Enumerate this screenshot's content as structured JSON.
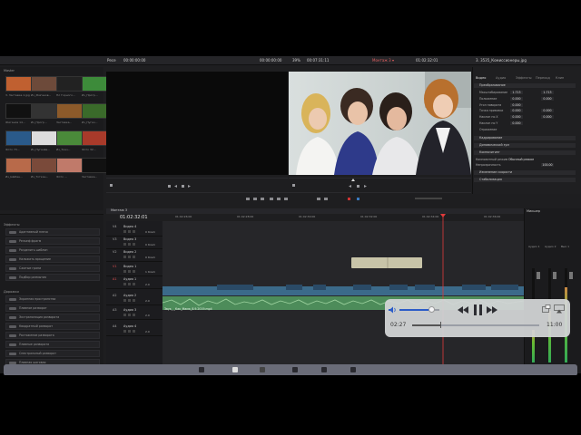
{
  "toolbar": {
    "left_label": "Ресе",
    "left_timecode": "00:00:00:00",
    "mid_timecode": "00:00:00:00",
    "zoom": "39%",
    "center_timecode": "00:07:31:11",
    "timeline_name": "Монтаж 3 ▾",
    "right_timecode": "01:02:32:01",
    "clip_name": "3. 3535_Комиссионеры.jpg"
  },
  "pool": {
    "title": "Master",
    "clips": [
      {
        "label": "3. Заставка-1.jpg",
        "color": "#c06030"
      },
      {
        "label": "Из_Жиганов...",
        "color": "#6d4a3a"
      },
      {
        "label": "Пл Горного...",
        "color": "#222"
      },
      {
        "label": "Из_Прогр...",
        "color": "#3d8b3a"
      },
      {
        "label": "Жиганов 14...",
        "color": "#111"
      },
      {
        "label": "Из_Прогр...",
        "color": "#333"
      },
      {
        "label": "Заставка...",
        "color": "#8c5a2a"
      },
      {
        "label": "Из_Пугач...",
        "color": "#3a6a2a"
      },
      {
        "label": "Фото 73...",
        "color": "#2a5a8a"
      },
      {
        "label": "Из_Пугачёв...",
        "color": "#ddd"
      },
      {
        "label": "Из_Ткач...",
        "color": "#4a8a3a"
      },
      {
        "label": "Фото 32...",
        "color": "#a83a2a"
      },
      {
        "label": "Из_Шабан...",
        "color": "#b86a4a"
      },
      {
        "label": "Из_Тоткин...",
        "color": "#7a4a3a"
      },
      {
        "label": "Фото ...",
        "color": "#c07a6a"
      },
      {
        "label": "Заставка...",
        "color": "#111"
      }
    ]
  },
  "effects": {
    "title": "Эффекты",
    "items": [
      "Адаптивный плечо",
      "Рельеф фрагм",
      "Разделить шаблон",
      "Наложить вращение",
      "Сжатые грани",
      "Подбор размытия"
    ],
    "section2": "Дорожки",
    "items2": [
      "Экранная пространства",
      "Плавное разворот",
      "Экстраполяция разворота",
      "Квадратный разворот",
      "Растяжение разворота",
      "Плавные разворота",
      "Спектральный разворот",
      "Плавная шаговая"
    ]
  },
  "inspector": {
    "tabs": [
      "Видео",
      "Аудио",
      "Эффекты",
      "Переход",
      "Клип"
    ],
    "section_transform": "Преобразование",
    "rows": [
      {
        "label": "Масштабирование",
        "a": "1.713",
        "b": "1.713"
      },
      {
        "label": "Положение",
        "a": "0.000",
        "b": "0.000"
      },
      {
        "label": "Угол поворота",
        "a": "0.000",
        "b": ""
      },
      {
        "label": "Точка привязки",
        "a": "0.000",
        "b": "0.000"
      },
      {
        "label": "Наклон по X",
        "a": "0.000",
        "b": "0.000"
      },
      {
        "label": "Наклон по Y",
        "a": "0.000",
        "b": ""
      },
      {
        "label": "Отражение",
        "a": "",
        "b": ""
      }
    ],
    "section_crop": "Кадрирование",
    "section_dynamic": "Динамический зум",
    "section_composite": "Композитинг",
    "composite_mode_label": "Композитный режим",
    "composite_mode": "Обычный режим",
    "opacity_label": "Непрозрачность",
    "opacity": "100.00",
    "section_speed": "Изменение скорости",
    "section_stabilize": "Стабилизация"
  },
  "timeline": {
    "timecode": "01:02:32:01",
    "tab": "Монтаж 3",
    "ruler": [
      "01:02:26:00",
      "01:02:28:00",
      "01:02:30:00",
      "01:02:32:00",
      "01:02:34:00",
      "01:02:36:00"
    ],
    "tracks": [
      {
        "id": "V4",
        "name": "Видео 4",
        "count": "0 Клип"
      },
      {
        "id": "V3",
        "name": "Видео 3",
        "count": "0 Клип"
      },
      {
        "id": "V2",
        "name": "Видео 2",
        "count": "0 Клип"
      },
      {
        "id": "V1",
        "name": "Видео 1",
        "count": "1 Клип"
      },
      {
        "id": "A1",
        "name": "Аудио 1",
        "count": "2.0"
      },
      {
        "id": "A2",
        "name": "Аудио 2",
        "count": "2.0"
      },
      {
        "id": "A3",
        "name": "Аудио 3",
        "count": "2.0"
      },
      {
        "id": "A4",
        "name": "Аудио 4",
        "count": "2.0"
      }
    ],
    "audio_clip_label": "Звук_ _Как_Мама_8.9.2019.mp4"
  },
  "mixer": {
    "title": "Микшер",
    "channels": [
      "Аудио 1",
      "Аудио 2",
      "Вых 1"
    ],
    "levels": [
      0.35,
      0.55,
      0.8
    ]
  },
  "player": {
    "elapsed": "02:27",
    "total": "11:00",
    "progress": 0.22,
    "volume": 0.8
  },
  "colors": {
    "accent": "#e03a3a",
    "clip_video": "#3b6a8a",
    "clip_audio": "#5f9a5f",
    "title_clip": "#c8c4a8"
  }
}
